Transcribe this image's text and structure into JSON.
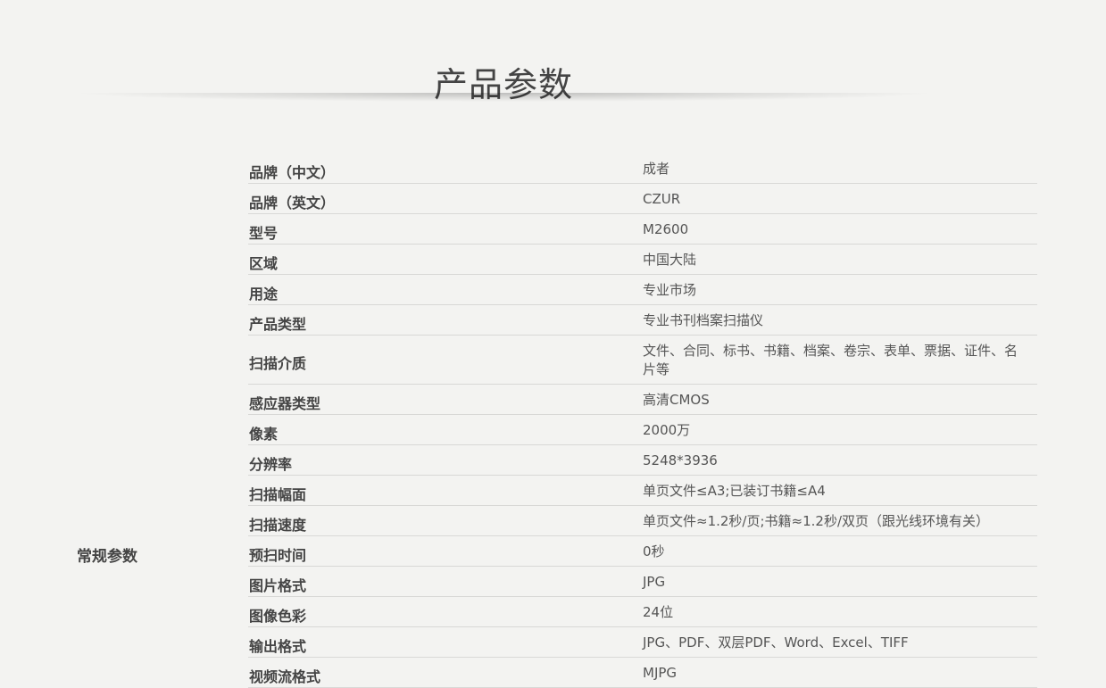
{
  "page": {
    "title": "产品参数",
    "section_label": "常规参数"
  },
  "specs": [
    {
      "key": "品牌（中文）",
      "value": "成者"
    },
    {
      "key": "品牌（英文）",
      "value": "CZUR"
    },
    {
      "key": "型号",
      "value": "M2600"
    },
    {
      "key": "区域",
      "value": "中国大陆"
    },
    {
      "key": "用途",
      "value": "专业市场"
    },
    {
      "key": "产品类型",
      "value": "专业书刊档案扫描仪"
    },
    {
      "key": "扫描介质",
      "value": "文件、合同、标书、书籍、档案、卷宗、表单、票据、证件、名片等",
      "tall": true
    },
    {
      "key": "感应器类型",
      "value": "高清CMOS"
    },
    {
      "key": "像素",
      "value": "2000万"
    },
    {
      "key": "分辨率",
      "value": "5248*3936"
    },
    {
      "key": "扫描幅面",
      "value": "单页文件≤A3;已装订书籍≤A4"
    },
    {
      "key": "扫描速度",
      "value": "单页文件≈1.2秒/页;书籍≈1.2秒/双页（跟光线环境有关）"
    },
    {
      "key": "预扫时间",
      "value": "0秒"
    },
    {
      "key": "图片格式",
      "value": "JPG"
    },
    {
      "key": "图像色彩",
      "value": "24位"
    },
    {
      "key": "输出格式",
      "value": "JPG、PDF、双层PDF、Word、Excel、TIFF"
    },
    {
      "key": "视频流格式",
      "value": "MJPG"
    }
  ]
}
